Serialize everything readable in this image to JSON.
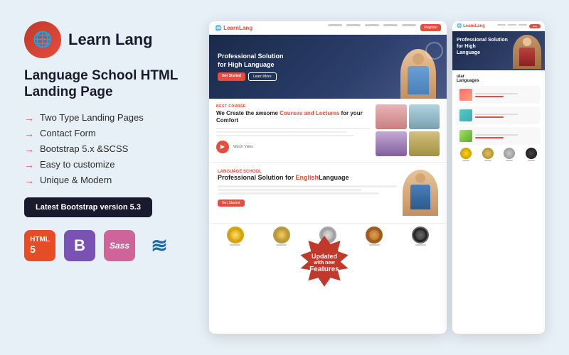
{
  "brand": {
    "name": "Learn Lang",
    "icon": "🌐"
  },
  "product": {
    "title": "Language School HTML Landing Page"
  },
  "features": {
    "list": [
      "Two Type Landing Pages",
      "Contact Form",
      "Bootstrap 5.x &SCSS",
      "Easy to customize",
      "Unique & Modern"
    ]
  },
  "badge_button": {
    "label": "Latest Bootstrap version 5.3"
  },
  "tech_icons": [
    {
      "name": "HTML5",
      "symbol": "5"
    },
    {
      "name": "Bootstrap",
      "symbol": "B"
    },
    {
      "name": "Sass",
      "symbol": "Sass"
    },
    {
      "name": "jQuery",
      "symbol": "≋"
    }
  ],
  "update_badge": {
    "line1": "Updated",
    "line2": "with new",
    "line3": "Features"
  },
  "preview": {
    "nav_logo": "LearnLang",
    "hero_title": "Professional Solution for High Language",
    "section_tag": "BEST COURSE",
    "section_h2_start": "We Create the awsome ",
    "section_h2_highlight": "Courses and Lectures",
    "section_h2_end": " for your Comfort",
    "pro_label": "LANGUAGE SCHOOL",
    "pro_title_start": "Professional Solution for ",
    "pro_title_highlight": "English",
    "pro_title_end": "Language"
  },
  "colors": {
    "accent": "#e74c3c",
    "dark": "#1a2a4a",
    "badge_bg": "#c0392b",
    "html_orange": "#e44d26",
    "bs_purple": "#7952b3",
    "sass_pink": "#cf649a",
    "light_bg": "#e8f0f7"
  }
}
